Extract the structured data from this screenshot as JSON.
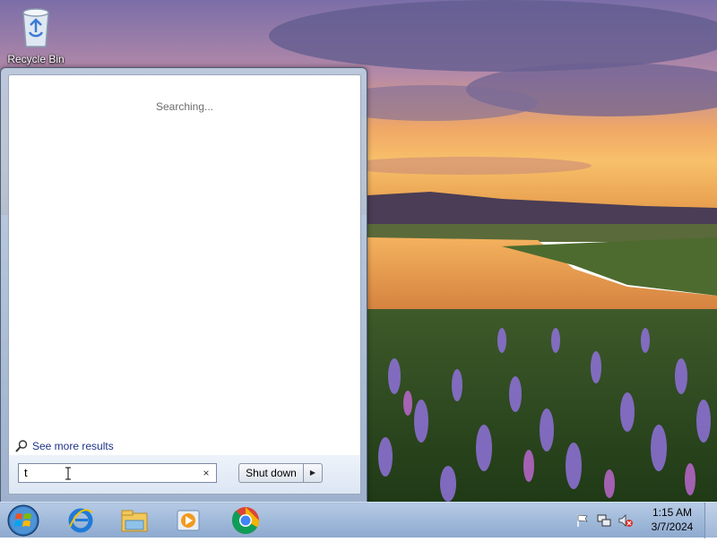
{
  "desktop": {
    "icons": [
      {
        "label": "Recycle Bin",
        "icon": "recycle-bin-icon"
      }
    ]
  },
  "start_menu": {
    "status_text": "Searching...",
    "see_more_label": "See more results",
    "search": {
      "value": "t"
    },
    "clear_icon": "×",
    "shutdown_label": "Shut down",
    "shutdown_arrow": "▶"
  },
  "taskbar": {
    "pinned": [
      "internet-explorer-icon",
      "file-explorer-icon",
      "media-player-icon",
      "chrome-icon"
    ],
    "clock": {
      "time": "1:15 AM",
      "date": "3/7/2024"
    },
    "tray": [
      "flag-icon",
      "network-icon",
      "volume-muted-icon"
    ]
  },
  "colors": {
    "accent": "#1e3287",
    "taskbar": "#9bb7db"
  }
}
